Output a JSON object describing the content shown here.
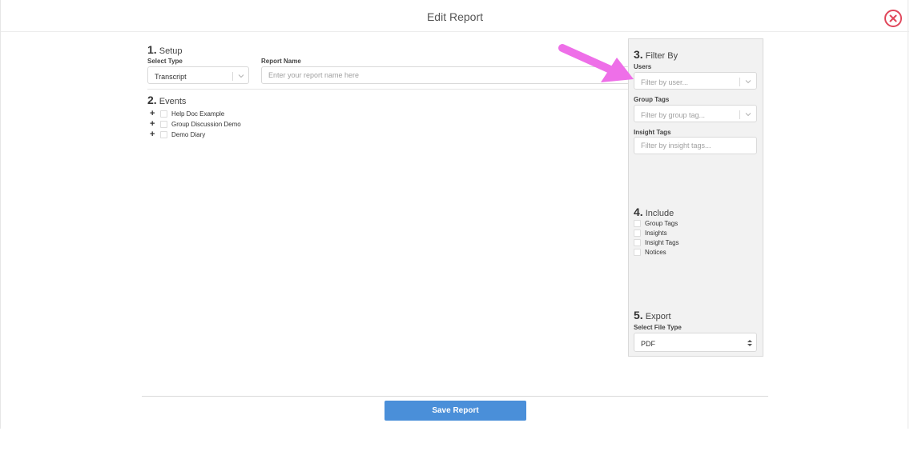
{
  "header": {
    "title": "Edit Report"
  },
  "setup": {
    "num": "1.",
    "title": "Setup",
    "select_type_label": "Select Type",
    "select_type_value": "Transcript",
    "report_name_label": "Report Name",
    "report_name_placeholder": "Enter your report name here"
  },
  "events": {
    "num": "2.",
    "title": "Events",
    "items": [
      {
        "label": "Help Doc Example"
      },
      {
        "label": "Group Discussion Demo"
      },
      {
        "label": "Demo Diary"
      }
    ]
  },
  "filter": {
    "num": "3.",
    "title": "Filter By",
    "users_label": "Users",
    "users_placeholder": "Filter by user...",
    "group_tags_label": "Group Tags",
    "group_tags_placeholder": "Filter by group tag...",
    "insight_tags_label": "Insight Tags",
    "insight_tags_placeholder": "Filter by insight tags..."
  },
  "include": {
    "num": "4.",
    "title": "Include",
    "items": [
      {
        "label": "Group Tags"
      },
      {
        "label": "Insights"
      },
      {
        "label": "Insight Tags"
      },
      {
        "label": "Notices"
      }
    ]
  },
  "export": {
    "num": "5.",
    "title": "Export",
    "file_type_label": "Select File Type",
    "file_type_value": "PDF"
  },
  "footer": {
    "save_label": "Save Report"
  },
  "colors": {
    "accent": "#4a8fd9",
    "close": "#e0465a",
    "annotation_arrow": "#ee6fe8"
  },
  "icons": {
    "close": "close-circle-icon",
    "chevron": "chevron-down-icon",
    "plus": "plus-icon",
    "sort": "sort-arrows-icon"
  }
}
